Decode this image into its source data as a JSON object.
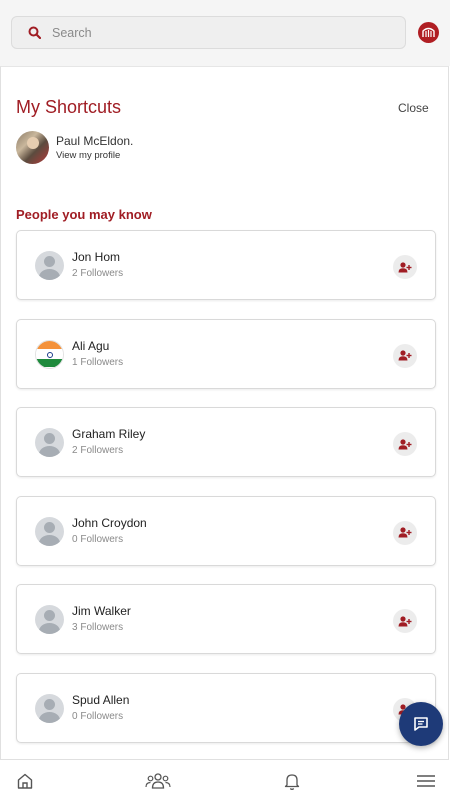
{
  "search": {
    "placeholder": "Search"
  },
  "shortcuts": {
    "title": "My Shortcuts",
    "close_label": "Close",
    "profile": {
      "name": "Paul McEldon.",
      "link_label": "View my profile"
    }
  },
  "people_section": {
    "title": "People you may know",
    "people": [
      {
        "name": "Jon Hom",
        "followers": "2 Followers",
        "avatar": "default"
      },
      {
        "name": "Ali Agu",
        "followers": "1 Followers",
        "avatar": "india-flag"
      },
      {
        "name": "Graham Riley",
        "followers": "2 Followers",
        "avatar": "default"
      },
      {
        "name": "John Croydon",
        "followers": "0 Followers",
        "avatar": "default"
      },
      {
        "name": "Jim Walker",
        "followers": "3 Followers",
        "avatar": "default"
      },
      {
        "name": "Spud Allen",
        "followers": "0 Followers",
        "avatar": "default"
      }
    ]
  },
  "colors": {
    "brand": "#a01d24",
    "fab": "#1e3a78"
  },
  "nav": [
    "home-icon",
    "groups-icon",
    "bell-icon",
    "menu-icon"
  ]
}
